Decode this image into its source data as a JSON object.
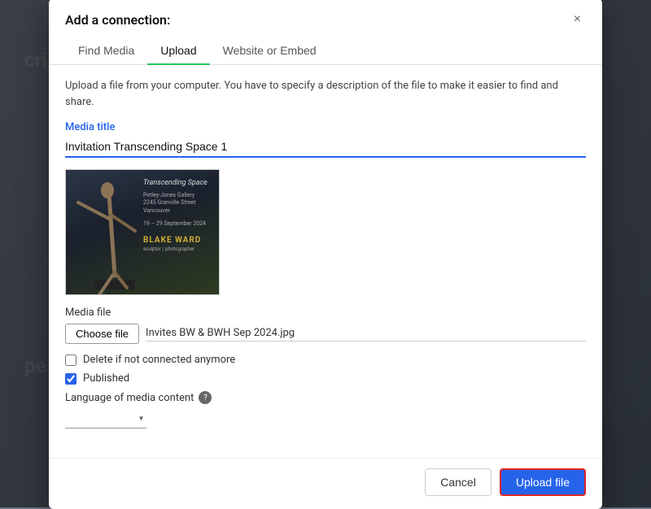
{
  "background": {
    "color": "#4b5563"
  },
  "modal": {
    "title": "Add a connection:",
    "close_label": "×",
    "description": "Upload a file from your computer. You have to specify a description of the file to make it easier to find and share.",
    "tabs": [
      {
        "id": "find-media",
        "label": "Find Media",
        "active": false
      },
      {
        "id": "upload",
        "label": "Upload",
        "active": true
      },
      {
        "id": "website-embed",
        "label": "Website or Embed",
        "active": false
      }
    ],
    "fields": {
      "media_title_label": "Media title",
      "media_title_value": "Invitation Transcending Space 1",
      "media_file_label": "Media file",
      "choose_file_label": "Choose file",
      "file_name": "Invites BW & BWH Sep 2024.jpg",
      "delete_if_not_connected": {
        "label": "Delete if not connected anymore",
        "checked": false
      },
      "published": {
        "label": "Published",
        "checked": true
      },
      "language_label": "Language of media content",
      "language_help": "?",
      "language_value": ""
    },
    "footer": {
      "cancel_label": "Cancel",
      "upload_label": "Upload file"
    },
    "image_preview": {
      "title_line": "Transcending Space",
      "gallery_line": "Petley-Jones Gallery",
      "address_line": "2245 Granville Street Vancouver",
      "date_line": "19 – 29 September 2024",
      "artist_name": "BLAKE WARD",
      "artist_sub": "sculptor / photographer"
    }
  }
}
